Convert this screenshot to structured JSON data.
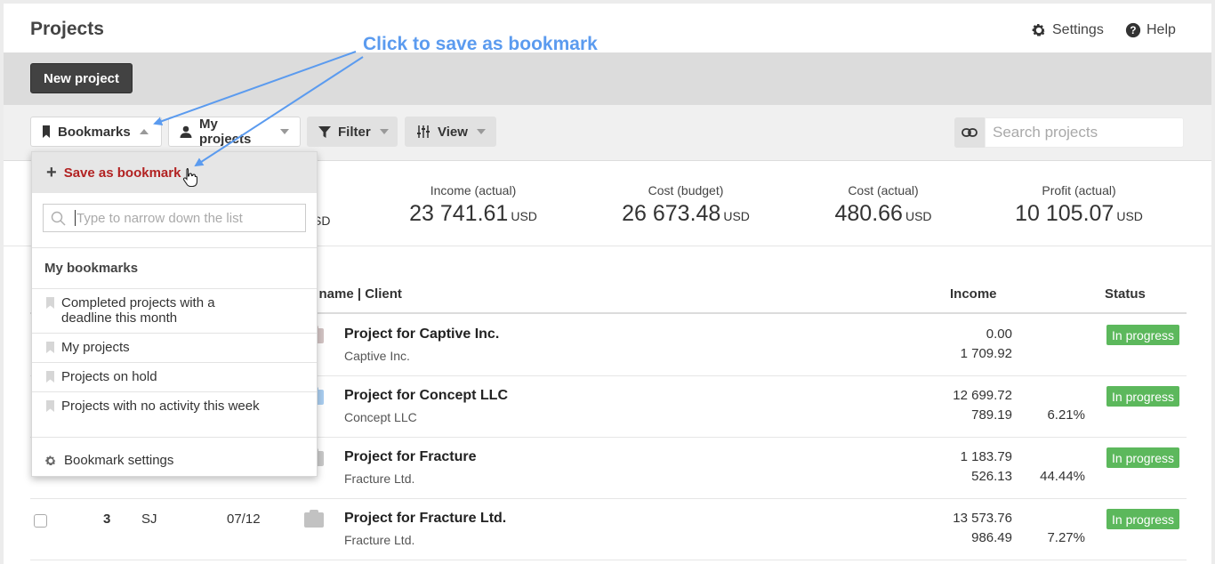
{
  "header": {
    "title": "Projects",
    "settings_label": "Settings",
    "help_label": "Help"
  },
  "actions": {
    "new_project_label": "New project"
  },
  "toolbar": {
    "bookmarks_label": "Bookmarks",
    "my_projects_label": "My projects",
    "filter_label": "Filter",
    "view_label": "View",
    "search_placeholder": "Search projects"
  },
  "stats": {
    "partial_currency": "SD",
    "items": [
      {
        "label": "Income (actual)",
        "value": "23 741.61",
        "currency": "USD"
      },
      {
        "label": "Cost (budget)",
        "value": "26 673.48",
        "currency": "USD"
      },
      {
        "label": "Cost (actual)",
        "value": "480.66",
        "currency": "USD"
      },
      {
        "label": "Profit (actual)",
        "value": "10 105.07",
        "currency": "USD"
      }
    ]
  },
  "table": {
    "col_name": "ct name | Client",
    "col_income": "Income",
    "col_status": "Status",
    "rows": [
      {
        "name": "Project for Captive Inc.",
        "client": "Captive Inc.",
        "income1": "0.00",
        "income2": "1 709.92",
        "pct": "",
        "status": "In progress",
        "folder_color": "#d2c3c3"
      },
      {
        "name": "Project for Concept LLC",
        "client": "Concept LLC",
        "income1": "12 699.72",
        "income2": "789.19",
        "pct": "6.21%",
        "status": "In progress",
        "folder_color": "#a9cdef"
      },
      {
        "name": "Project for Fracture",
        "client": "Fracture Ltd.",
        "income1": "1 183.79",
        "income2": "526.13",
        "pct": "44.44%",
        "status": "In progress",
        "folder_color": "#c8c8c8"
      },
      {
        "num": "3",
        "initials": "SJ",
        "date": "07/12",
        "name": "Project for Fracture Ltd.",
        "client": "Fracture Ltd.",
        "income1": "13 573.76",
        "income2": "986.49",
        "pct": "7.27%",
        "status": "In progress",
        "folder_color": "#c2c2c2"
      }
    ]
  },
  "dropdown": {
    "save_label": "Save as bookmark",
    "search_placeholder": "Type to narrow down the list",
    "section_title": "My bookmarks",
    "items": [
      "Completed projects with a deadline this month",
      "My projects",
      "Projects on hold",
      "Projects with no activity this week"
    ],
    "settings_label": "Bookmark settings"
  },
  "annotation": {
    "text": "Click to save as bookmark",
    "color": "#5b9bef"
  },
  "colors": {
    "status_green": "#5cb85c",
    "save_red": "#b22222",
    "dark_button": "#424242"
  }
}
